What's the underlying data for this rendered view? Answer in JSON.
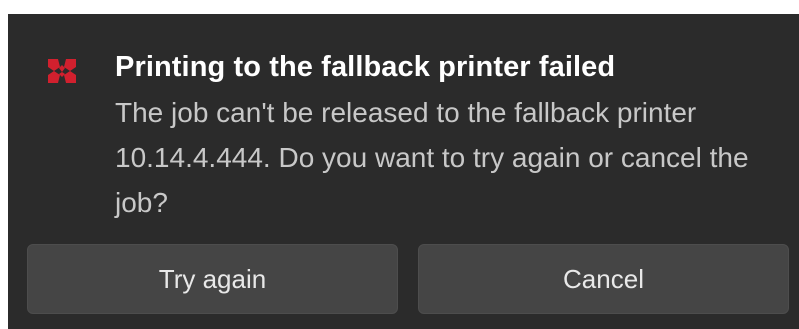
{
  "notification": {
    "app_icon": "kyocera-logo-icon",
    "title": "Printing to the fallback printer failed",
    "message": "The job can't be released to the fallback printer 10.14.4.444. Do you want to try again or cancel the job?"
  },
  "actions": {
    "try_again_label": "Try again",
    "cancel_label": "Cancel"
  },
  "colors": {
    "background": "#2b2b2b",
    "accent_icon": "#d1202e",
    "button_background": "#454545",
    "title_text": "#ffffff",
    "body_text": "#c8c8c8"
  }
}
